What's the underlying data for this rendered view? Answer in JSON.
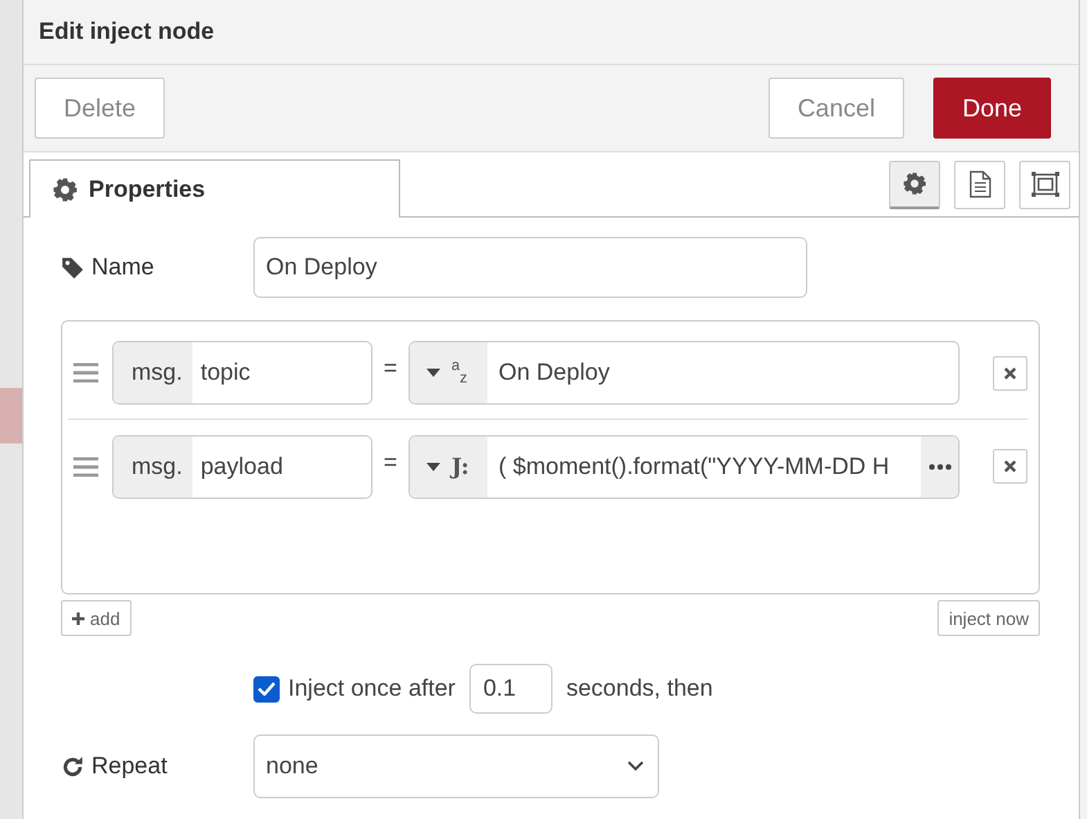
{
  "window": {
    "title": "Edit inject node"
  },
  "actions": {
    "delete": "Delete",
    "cancel": "Cancel",
    "done": "Done"
  },
  "tabs": [
    {
      "label": "Properties",
      "selected": true
    }
  ],
  "side_tabs": [
    {
      "kind": "settings",
      "selected": true
    },
    {
      "kind": "description",
      "selected": false
    },
    {
      "kind": "appearance",
      "selected": false
    }
  ],
  "name": {
    "label": "Name",
    "value": "On Deploy"
  },
  "properties": [
    {
      "prefix": "msg.",
      "key": "topic",
      "equals": "=",
      "kind": "string",
      "type_glyph": "$^{a}$$_{z}$",
      "value": "On Deploy",
      "expand": false
    },
    {
      "prefix": "msg.",
      "key": "payload",
      "equals": "=",
      "kind": "jsonata",
      "type_glyph": "J:",
      "value": "( $moment().format(\"YYYY-MM-DD H",
      "expand": true
    }
  ],
  "add_button": "add",
  "inject_button": "inject now",
  "once": {
    "checked": true,
    "label": "Inject once after",
    "value": "0.1",
    "suffix": "seconds, then"
  },
  "repeat": {
    "label": "Repeat",
    "value": "none"
  }
}
